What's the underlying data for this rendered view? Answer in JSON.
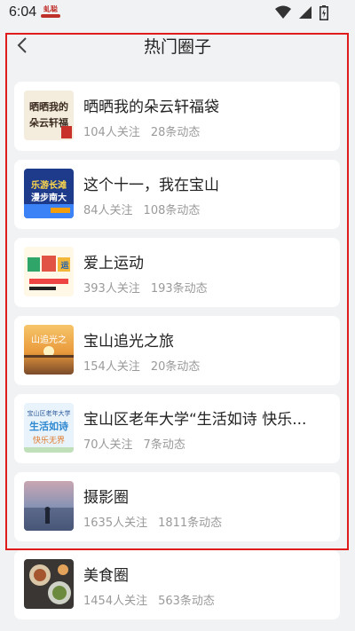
{
  "status_bar": {
    "time": "6:04",
    "app_icon_text": "虬聪"
  },
  "header": {
    "title": "热门圈子",
    "back_icon": "chevron-left-icon"
  },
  "circles": [
    {
      "title": "晒晒我的朵云轩福袋",
      "followers": "104人关注",
      "posts": "28条动态",
      "thumb_text": "晒晒我的 朵云轩福袋"
    },
    {
      "title": "这个十一，我在宝山",
      "followers": "84人关注",
      "posts": "108条动态",
      "thumb_text": "乐游长滩 漫步南大"
    },
    {
      "title": "爱上运动",
      "followers": "393人关注",
      "posts": "193条动态",
      "thumb_text": "爱运"
    },
    {
      "title": "宝山追光之旅",
      "followers": "154人关注",
      "posts": "20条动态",
      "thumb_text": "山追光之"
    },
    {
      "title": "宝山区老年大学“生活如诗 快乐...",
      "followers": "70人关注",
      "posts": "7条动态",
      "thumb_text": "宝山区老年大学 生活如诗 快乐无界"
    },
    {
      "title": "摄影圈",
      "followers": "1635人关注",
      "posts": "1811条动态",
      "thumb_text": ""
    },
    {
      "title": "美食圈",
      "followers": "1454人关注",
      "posts": "563条动态",
      "thumb_text": ""
    }
  ],
  "colors": {
    "background": "#f1f2f4",
    "card": "#ffffff",
    "highlight": "#e01b1b",
    "meta_text": "#9a9a9a"
  }
}
